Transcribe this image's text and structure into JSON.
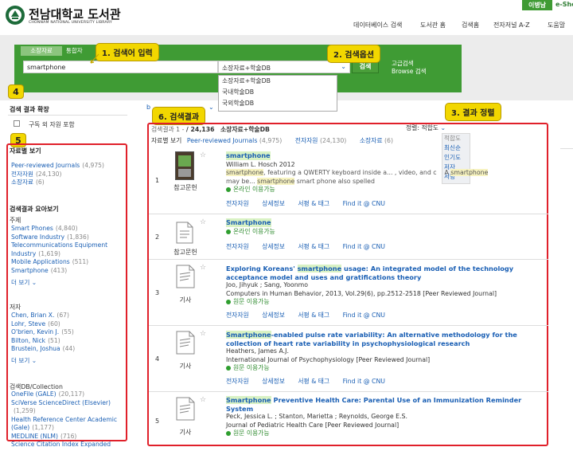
{
  "header": {
    "logo_kr": "전남대학교 도서관",
    "logo_en": "CHONNAM NATIONAL UNIVERSITY LIBRARY",
    "user_badge": "이병남",
    "eshelf": "e-She",
    "nav": [
      "데이터베이스 검색",
      "도서관 홈",
      "검색홈",
      "전자저널 A-Z",
      "도움말"
    ]
  },
  "search": {
    "tabs": [
      "소장자료",
      "통합자"
    ],
    "query": "smartphone",
    "scope_selected": "소장자료+학술DB",
    "scope_options": [
      "소장자료+학술DB",
      "국내학술DB",
      "국외학술DB"
    ],
    "search_button": "검색",
    "advanced": "고급검색",
    "browse": "Browse 검색"
  },
  "callouts": {
    "c1": "1. 검색어 입력",
    "c2": "2. 검색옵션",
    "c3": "3. 결과 정렬",
    "c6": "6. 검색결과",
    "n4": "4",
    "n5": "5"
  },
  "left": {
    "expand_title": "검색 결과 확장",
    "expand_check": "구독 외 자원 포함",
    "type_title": "자료별 보기",
    "types": [
      {
        "label": "Peer-reviewed Journals",
        "count": "(4,975)"
      },
      {
        "label": "전자자원",
        "count": "(24,130)"
      },
      {
        "label": "소장자료",
        "count": "(6)"
      }
    ],
    "summary_title": "검색결과 요아보기",
    "subject_title": "주제",
    "subjects": [
      {
        "label": "Smart Phones",
        "count": "(4,840)"
      },
      {
        "label": "Software Industry",
        "count": "(1,836)"
      },
      {
        "label": "Telecommunications Equipment Industry",
        "count": "(1,619)"
      },
      {
        "label": "Mobile Applications",
        "count": "(511)"
      },
      {
        "label": "Smartphone",
        "count": "(413)"
      }
    ],
    "more": "더 보기",
    "author_title": "저자",
    "authors": [
      {
        "label": "Chen, Brian X.",
        "count": "(67)"
      },
      {
        "label": "Lohr, Steve",
        "count": "(60)"
      },
      {
        "label": "O'brien, Kevin J.",
        "count": "(55)"
      },
      {
        "label": "Bilton, Nick",
        "count": "(51)"
      },
      {
        "label": "Brustein, Joshua",
        "count": "(44)"
      }
    ],
    "db_title": "검색DB/Collection",
    "dbs": [
      {
        "label": "OneFile (GALE)",
        "count": "(20,117)"
      },
      {
        "label": "SciVerse ScienceDirect (Elsevier)",
        "count": "(1,259)"
      },
      {
        "label": "Health Reference Center Academic (Gale)",
        "count": "(1,177)"
      },
      {
        "label": "MEDLINE (NLM)",
        "count": "(716)"
      },
      {
        "label": "Science Citation Index Expanded",
        "count": ""
      }
    ]
  },
  "results": {
    "crumb": "b",
    "summary_prefix": "검색결과 1 - ",
    "summary_total": "/ 24,136",
    "summary_scope": "소장자료+학술DB",
    "sort_label": "정렬: 적합도",
    "sort_options": [
      "적합도",
      "최신순",
      "인기도",
      "저자",
      "서명"
    ],
    "filter_label": "자료별 보기",
    "filters": [
      {
        "label": "Peer-reviewed Journals",
        "count": "(4,975)"
      },
      {
        "label": "전자자원",
        "count": "(24,130)"
      },
      {
        "label": "소장자료",
        "count": "(6)"
      }
    ],
    "action_labels": [
      "전자자원",
      "상세정보",
      "서평 & 태그",
      "Find it @ CNU"
    ],
    "items": [
      {
        "num": "1",
        "type": "참고문헌",
        "title": "smartphone",
        "line1": "William L. Hosch 2012",
        "snip_a": "smartphone",
        "snip_b": ", featuring a QWERTY keyboard inside a... , video, and c",
        "snip_c": "A ",
        "snip_d": "smartphone",
        "snip2_a": "may be... ",
        "snip2_b": "smartphone",
        "snip2_c": " smart phone also spelled",
        "avail": "온라인 이용가능"
      },
      {
        "num": "2",
        "type": "참고문헌",
        "title": "Smartphone",
        "avail": "온라인 이용가능"
      },
      {
        "num": "3",
        "type": "기사",
        "title_a": "Exploring Koreans' ",
        "title_hl": "smartphone",
        "title_b": " usage: An integrated model of the technology acceptance model and uses and gratifications theory",
        "authors": "Joo, Jihyuk ; Sang, Yoonmo",
        "source": "Computers in Human Behavior, 2013, Vol.29(6), pp.2512-2518 [Peer Reviewed Journal]",
        "avail": "원문 이용가능"
      },
      {
        "num": "4",
        "type": "기사",
        "title_hl": "Smartphone",
        "title_b": "-enabled pulse rate variability: An alternative methodology for the collection of heart rate variability in psychophysiological research",
        "authors": "Heathers, James A.J.",
        "source": "International Journal of Psychophysiology [Peer Reviewed Journal]",
        "avail": "원문 이용가능"
      },
      {
        "num": "5",
        "type": "기사",
        "title_hl": "Smartphone",
        "title_b": " Preventive Health Care: Parental Use of an Immunization Reminder System",
        "authors": "Peck, Jessica L. ; Stanton, Marietta ; Reynolds, George E.S.",
        "source": "Journal of Pediatric Health Care [Peer Reviewed Journal]",
        "avail": "원문 이용가능"
      }
    ]
  },
  "colors": {
    "green_band": "#3f9b34",
    "callout": "#f2d700",
    "red": "#e0202a",
    "link": "#1a5fb4"
  }
}
